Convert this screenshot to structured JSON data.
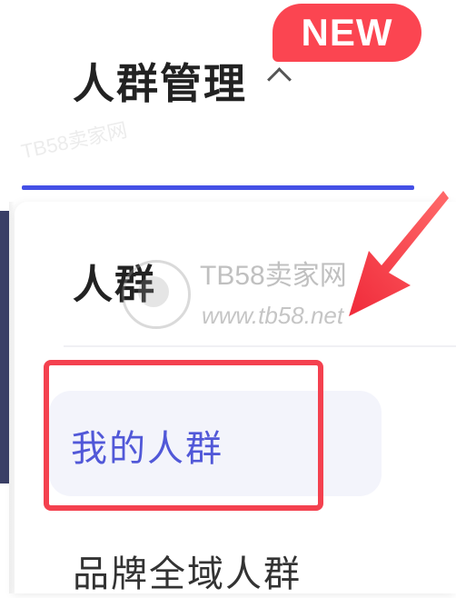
{
  "menu": {
    "title": "人群管理",
    "badge": "NEW",
    "chevron_icon": "chevron-up-icon",
    "accent_color": "#4450e6"
  },
  "dropdown": {
    "section_heading": "人群",
    "items": [
      {
        "label": "我的人群",
        "selected": true
      },
      {
        "label": "品牌全域人群",
        "selected": false
      }
    ]
  },
  "annotations": {
    "highlight_color": "#f4414f",
    "arrow_icon": "red-arrow-icon"
  },
  "watermark": {
    "title": "TB58卖家网",
    "url": "www.tb58.net",
    "faint": "TB58卖家网"
  }
}
